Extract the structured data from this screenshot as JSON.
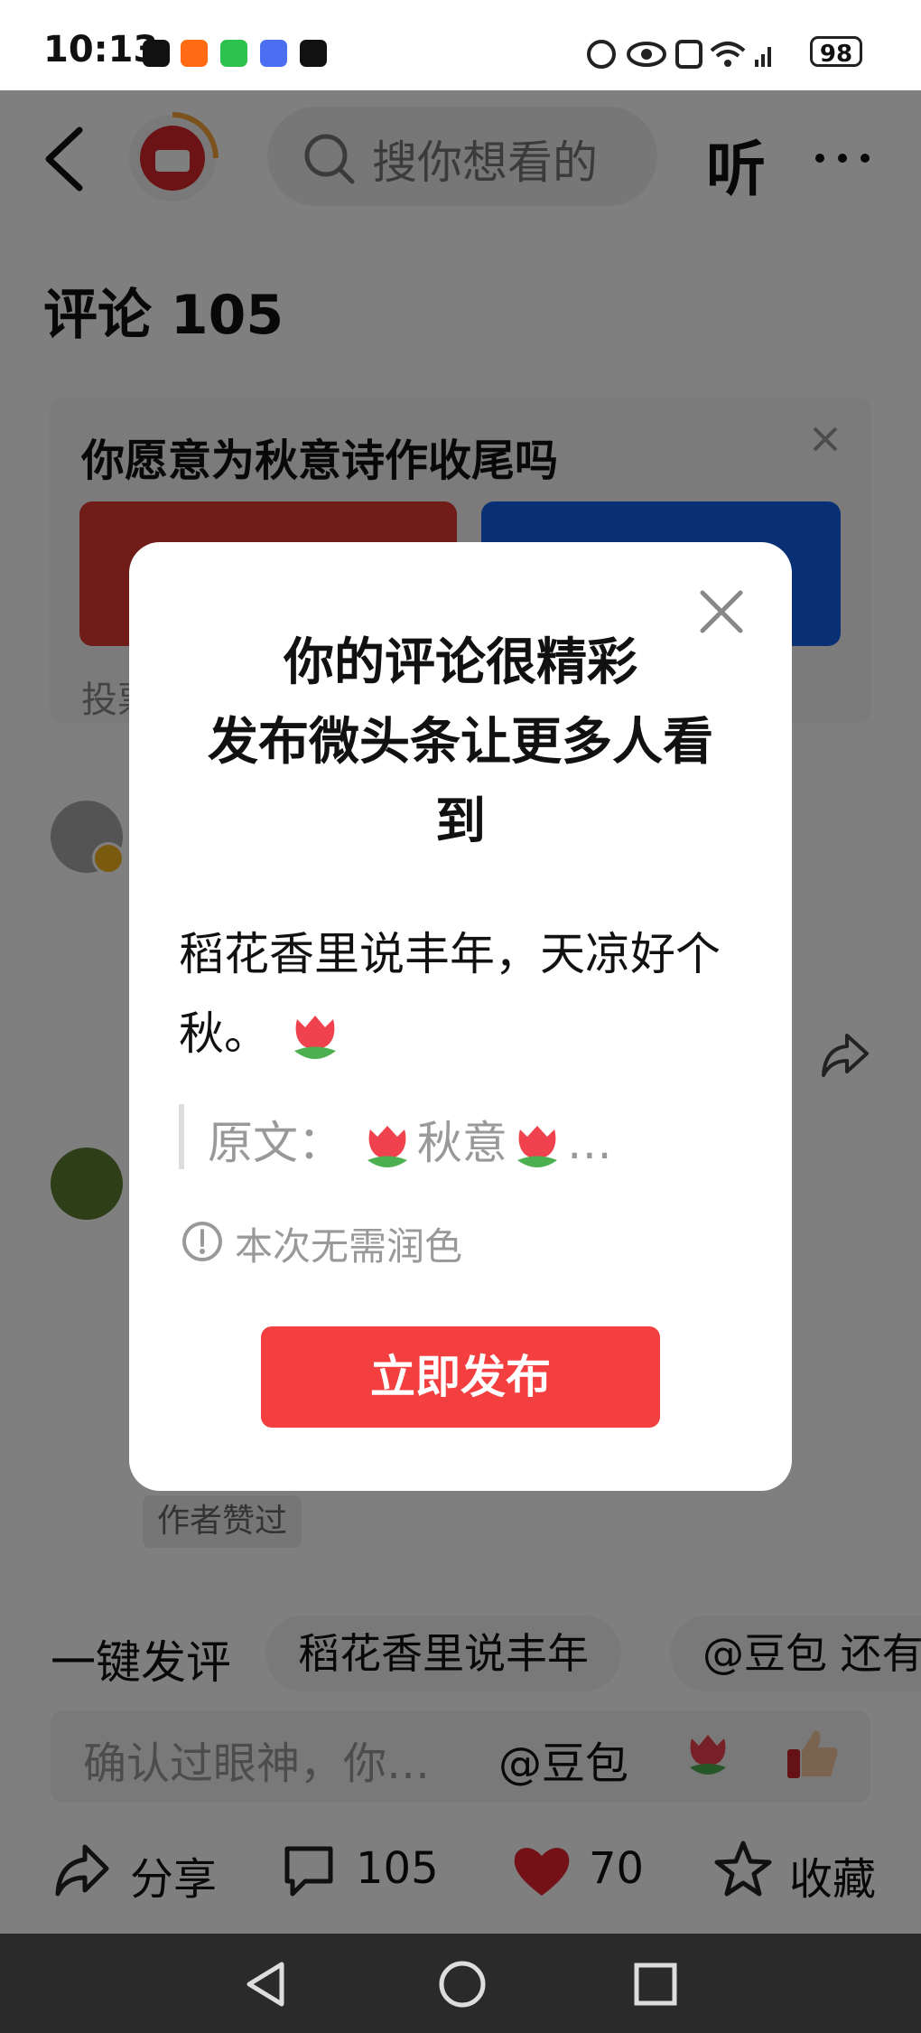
{
  "status_bar": {
    "time": "10:13",
    "battery": "98",
    "app_icons": [
      "tiktok-icon",
      "store-icon",
      "wechat-icon",
      "music-icon",
      "capcut-icon"
    ],
    "system_icons": [
      "nfc-icon",
      "eye-icon",
      "nfc-n-icon",
      "wifi-icon",
      "signal-icon"
    ]
  },
  "header": {
    "search_placeholder": "搜你想看的",
    "listen_label": "听"
  },
  "comments": {
    "title": "评论 105"
  },
  "vote": {
    "question": "你愿意为秋意诗作收尾吗",
    "hint": "投票"
  },
  "author_tag": "作者赞过",
  "modal": {
    "title_line1": "你的评论很精彩",
    "title_line2": "发布微头条让更多人看到",
    "body_text": "稻花香里说丰年，天凉好个秋。",
    "quote_prefix": "原文：",
    "quote_word": "秋意",
    "quote_ellipsis": "…",
    "note": "本次无需润色",
    "publish_label": "立即发布"
  },
  "quick_reply": {
    "label": "一键发评",
    "chips": [
      "稻花香里说丰年",
      "@豆包 还有"
    ]
  },
  "compose": {
    "placeholder": "确认过眼神，你…",
    "mention": "@豆包"
  },
  "bottom_bar": {
    "share": "分享",
    "comments": "105",
    "likes": "70",
    "favorite": "收藏"
  },
  "colors": {
    "accent_red": "#f33f3f",
    "vote_red": "#e03a33",
    "vote_blue": "#1260e8",
    "heart": "#e8232f"
  }
}
